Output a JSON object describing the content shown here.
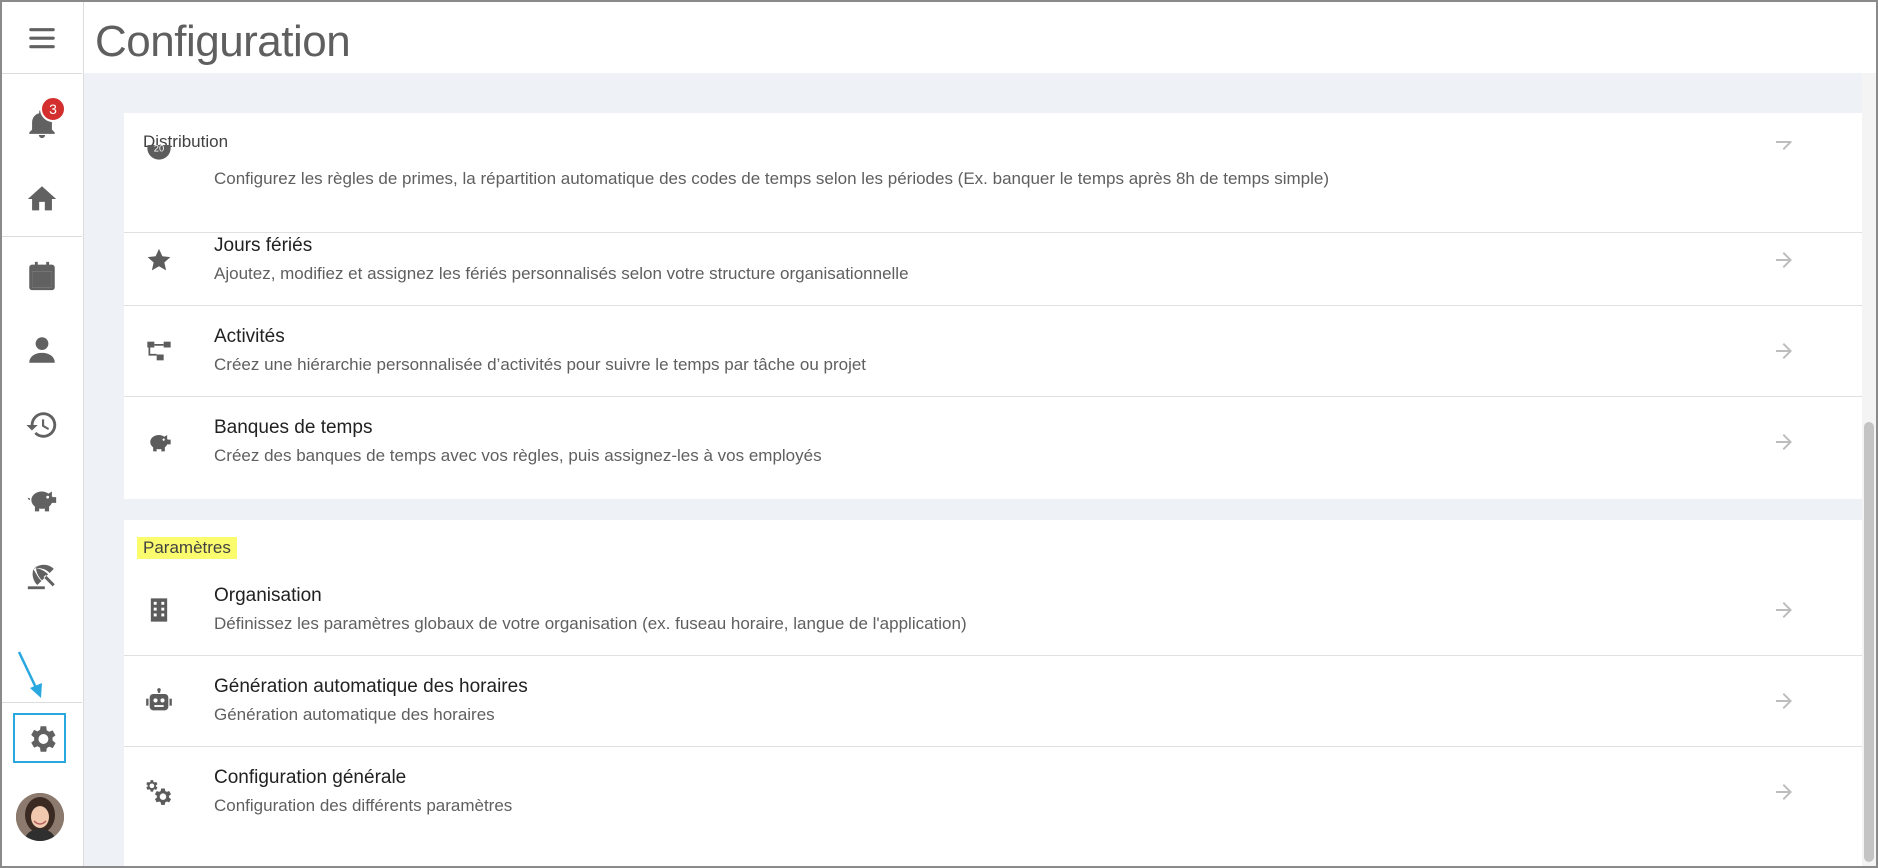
{
  "header": {
    "title": "Configuration"
  },
  "sidebar": {
    "notifications_count": "3",
    "items": [
      {
        "name": "menu-icon"
      },
      {
        "name": "bell-icon"
      },
      {
        "name": "home-icon"
      },
      {
        "name": "calendar-icon"
      },
      {
        "name": "person-icon"
      },
      {
        "name": "history-icon"
      },
      {
        "name": "piggy-bank-icon"
      },
      {
        "name": "beach-umbrella-icon"
      },
      {
        "name": "gear-icon"
      }
    ]
  },
  "sections": [
    {
      "title": "Distribution",
      "highlighted": false,
      "rows": [
        {
          "title": "",
          "description": "Configurez les règles de primes, la répartition automatique des codes de temps selon les périodes (Ex. banquer le temps après 8h de temps simple)",
          "icon": "clock-20-icon"
        },
        {
          "title": "Jours fériés",
          "description": "Ajoutez, modifiez et assignez les fériés personnalisés selon votre structure organisationnelle",
          "icon": "star-icon"
        },
        {
          "title": "Activités",
          "description": "Créez une hiérarchie personnalisée d’activités pour suivre le temps par tâche ou projet",
          "icon": "hierarchy-icon"
        },
        {
          "title": "Banques de temps",
          "description": "Créez des banques de temps avec vos règles, puis assignez-les à vos employés",
          "icon": "piggy-bank-icon"
        }
      ]
    },
    {
      "title": "Paramètres",
      "highlighted": true,
      "highlight_color": "#fbfb6e",
      "rows": [
        {
          "title": "Organisation",
          "description": "Définissez les paramètres globaux de votre organisation (ex. fuseau horaire, langue de l'application)",
          "icon": "building-icon"
        },
        {
          "title": "Génération automatique des horaires",
          "description": "Génération automatique des horaires",
          "icon": "robot-icon"
        },
        {
          "title": "Configuration générale",
          "description": "Configuration des différents paramètres",
          "icon": "gears-icon"
        }
      ]
    }
  ],
  "colors": {
    "accent_box": "#29a8e0",
    "badge": "#d32f2f",
    "background": "#eef1f6"
  }
}
